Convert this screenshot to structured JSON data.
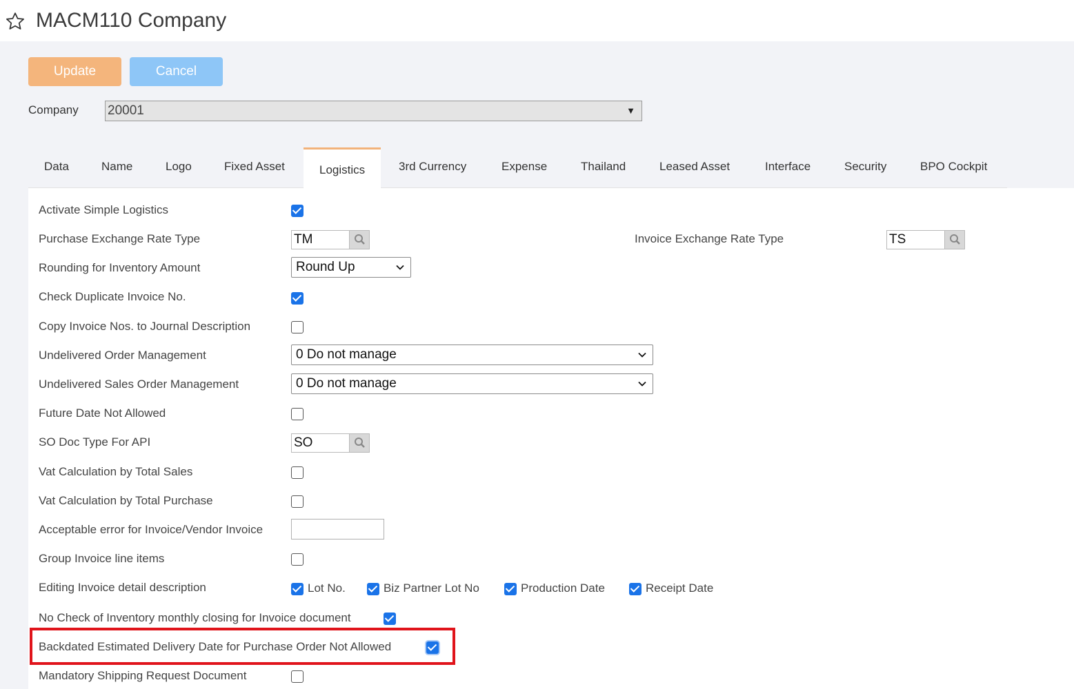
{
  "header": {
    "title": "MACM110 Company",
    "favorite_icon": "star-outline-icon"
  },
  "toolbar": {
    "update_label": "Update",
    "cancel_label": "Cancel"
  },
  "company": {
    "label": "Company",
    "value": "20001",
    "arrow": "▼"
  },
  "tabs": [
    {
      "label": "Data"
    },
    {
      "label": "Name"
    },
    {
      "label": "Logo"
    },
    {
      "label": "Fixed Asset"
    },
    {
      "label": "Logistics"
    },
    {
      "label": "3rd Currency"
    },
    {
      "label": "Expense"
    },
    {
      "label": "Thailand"
    },
    {
      "label": "Leased Asset"
    },
    {
      "label": "Interface"
    },
    {
      "label": "Security"
    },
    {
      "label": "BPO Cockpit"
    }
  ],
  "active_tab": "Logistics",
  "fields": {
    "activate_simple_logistics": {
      "label": "Activate Simple Logistics",
      "checked": true
    },
    "purchase_exchange_rate_type": {
      "label": "Purchase Exchange Rate Type",
      "value": "TM"
    },
    "invoice_exchange_rate_type": {
      "label": "Invoice Exchange Rate Type",
      "value": "TS"
    },
    "rounding_inventory_amount": {
      "label": "Rounding for Inventory Amount",
      "value": "Round Up"
    },
    "check_duplicate_invoice": {
      "label": "Check Duplicate Invoice No.",
      "checked": true
    },
    "copy_invoice_nos": {
      "label": "Copy Invoice Nos. to Journal Description",
      "checked": false
    },
    "undelivered_order_mgmt": {
      "label": "Undelivered Order Management",
      "value": "0 Do not manage"
    },
    "undelivered_sales_order_mgmt": {
      "label": "Undelivered Sales Order Management",
      "value": "0 Do not manage"
    },
    "future_date_not_allowed": {
      "label": "Future Date Not Allowed",
      "checked": false
    },
    "so_doc_type_for_api": {
      "label": "SO Doc Type For API",
      "value": "SO"
    },
    "vat_calc_total_sales": {
      "label": "Vat Calculation by Total Sales",
      "checked": false
    },
    "vat_calc_total_purchase": {
      "label": "Vat Calculation by Total Purchase",
      "checked": false
    },
    "acceptable_error": {
      "label": "Acceptable error for Invoice/Vendor Invoice",
      "value": ""
    },
    "group_invoice_line_items": {
      "label": "Group Invoice line items",
      "checked": false
    },
    "editing_invoice_detail": {
      "label": "Editing Invoice detail description",
      "options": [
        {
          "label": "Lot No.",
          "checked": true
        },
        {
          "label": "Biz Partner Lot No",
          "checked": true
        },
        {
          "label": "Production Date",
          "checked": true
        },
        {
          "label": "Receipt Date",
          "checked": true
        }
      ]
    },
    "no_check_inventory_closing": {
      "label": "No Check of Inventory monthly closing for Invoice document",
      "checked": true
    },
    "backdated_est_delivery": {
      "label": "Backdated Estimated Delivery Date for Purchase Order Not Allowed",
      "checked": true
    },
    "mandatory_shipping_request": {
      "label": "Mandatory Shipping Request Document",
      "checked": false
    }
  },
  "colors": {
    "accent_update": "#f4b57c",
    "accent_cancel": "#8ec6f7",
    "checkbox_on": "#1a73e8",
    "highlight": "#e0141b",
    "tab_active_border": "#f2b27a"
  }
}
